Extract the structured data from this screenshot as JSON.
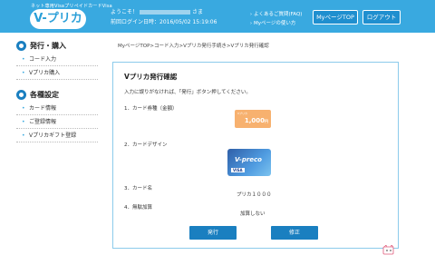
{
  "header": {
    "logo_tagline": "ネット専用VisaプリペイドカードVisa",
    "logo_text": "V-プリカ",
    "welcome_prefix": "ようこそ！",
    "welcome_suffix": "さま",
    "last_login": "前回ログイン日時：2016/05/02 15:19:06",
    "faq_link": "よくあるご質問(FAQ)",
    "howto_link": "Myページの使い方",
    "mypage_button": "MyページTOP",
    "logout_button": "ログアウト"
  },
  "sidebar": {
    "sections": [
      {
        "title": "発行・購入",
        "items": [
          "コード入力",
          "Vプリカ購入"
        ]
      },
      {
        "title": "各種設定",
        "items": [
          "カード情報",
          "ご登録情報",
          "Vプリカギフト登録"
        ]
      }
    ]
  },
  "breadcrumb": "MyページTOP>コード入力>Vプリカ発行手続き>Vプリカ発行確認",
  "panel": {
    "title": "Vプリカ発行確認",
    "intro": "入力に誤りがなければ、「発行」ボタン押してください。",
    "rows": {
      "amount_label": "1．カード券種（金額）",
      "design_label": "2．カードデザイン",
      "name_label": "3．カード名",
      "name_value": "プリカ１０００",
      "surcharge_label": "4．無駄加算",
      "surcharge_value": "加算しない"
    },
    "amount_card": {
      "tag": "Vプリカ",
      "value": "1,000",
      "unit": "円"
    },
    "design_card": {
      "logo": "V-preco",
      "brand": "VISA"
    },
    "issue_button": "発行",
    "edit_button": "修正"
  },
  "colors": {
    "header": "#39a9e0",
    "button": "#1a7fc0",
    "border": "#8ccbeb"
  }
}
